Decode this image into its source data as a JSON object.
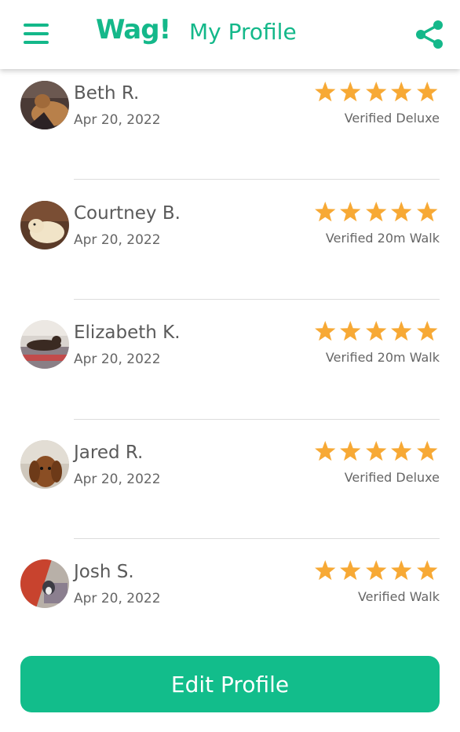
{
  "header": {
    "logo": "Wag!",
    "title": "My Profile"
  },
  "colors": {
    "brand": "#14b88a",
    "star": "#f7a935",
    "button": "#12bd8b"
  },
  "reviews": [
    {
      "name": "Beth R.",
      "date": "Apr 20, 2022",
      "rating": 5,
      "service": "Verified Deluxe"
    },
    {
      "name": "Courtney B.",
      "date": "Apr 20, 2022",
      "rating": 5,
      "service": "Verified 20m Walk"
    },
    {
      "name": "Elizabeth K.",
      "date": "Apr 20, 2022",
      "rating": 5,
      "service": "Verified 20m Walk"
    },
    {
      "name": "Jared R.",
      "date": "Apr 20, 2022",
      "rating": 5,
      "service": "Verified Deluxe"
    },
    {
      "name": "Josh S.",
      "date": "Apr 20, 2022",
      "rating": 5,
      "service": "Verified Walk"
    }
  ],
  "edit_button_label": "Edit Profile"
}
